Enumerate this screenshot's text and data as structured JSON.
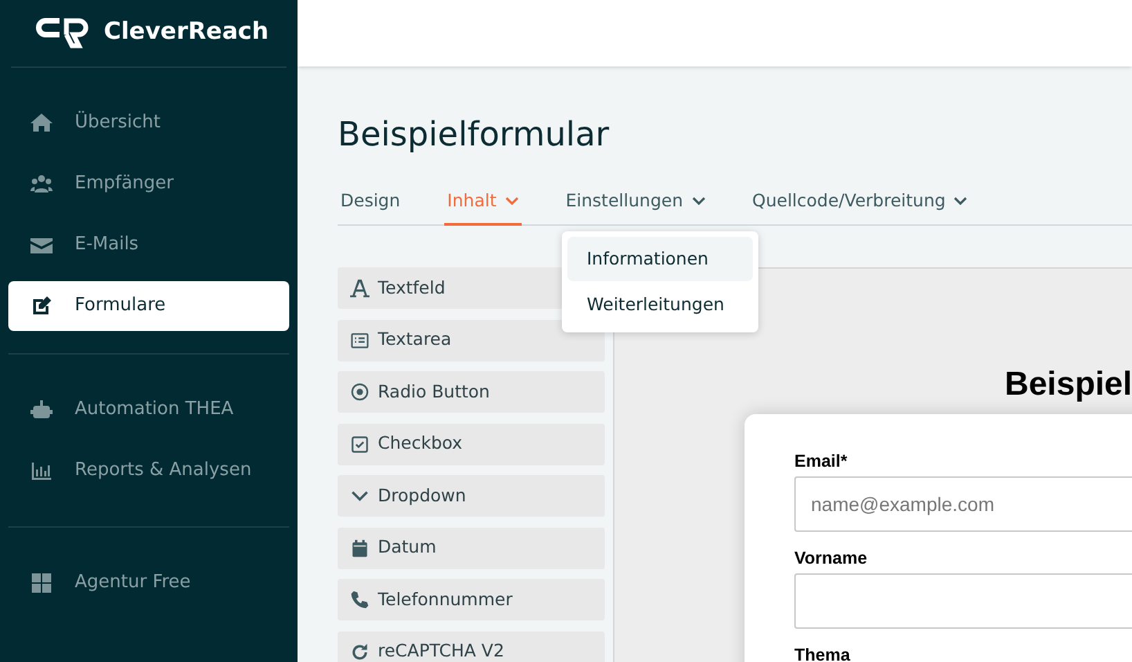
{
  "brand": {
    "name": "CleverReach"
  },
  "sidebar": {
    "groups": [
      {
        "items": [
          {
            "kind": "home",
            "label": "Übersicht",
            "selected": false
          },
          {
            "kind": "users",
            "label": "Empfänger",
            "selected": false
          },
          {
            "kind": "mail",
            "label": "E-Mails",
            "selected": false
          },
          {
            "kind": "edit",
            "label": "Formulare",
            "selected": true
          }
        ]
      },
      {
        "items": [
          {
            "kind": "robot",
            "label": "Automation THEA",
            "selected": false
          },
          {
            "kind": "chart",
            "label": "Reports & Analysen",
            "selected": false
          }
        ]
      },
      {
        "items": [
          {
            "kind": "grid",
            "label": "Agentur Free",
            "selected": false
          }
        ]
      }
    ]
  },
  "page": {
    "title": "Beispielformular"
  },
  "tabs": [
    {
      "label": "Design",
      "selected": false,
      "has_menu": false
    },
    {
      "label": "Inhalt",
      "selected": true,
      "has_menu": true
    },
    {
      "label": "Einstellungen",
      "selected": false,
      "has_menu": true
    },
    {
      "label": "Quellcode/Verbreitung",
      "selected": false,
      "has_menu": true
    }
  ],
  "dropdown": {
    "items": [
      {
        "label": "Informationen",
        "selected": true
      },
      {
        "label": "Weiterleitungen",
        "selected": false
      }
    ]
  },
  "palette": [
    {
      "kind": "text",
      "label": "Textfeld"
    },
    {
      "kind": "textarea",
      "label": "Textarea"
    },
    {
      "kind": "radio",
      "label": "Radio Button"
    },
    {
      "kind": "checkbox",
      "label": "Checkbox"
    },
    {
      "kind": "dropdown",
      "label": "Dropdown"
    },
    {
      "kind": "date",
      "label": "Datum"
    },
    {
      "kind": "phone",
      "label": "Telefonnummer"
    },
    {
      "kind": "captcha",
      "label": "reCAPTCHA V2"
    }
  ],
  "preview": {
    "title": "Beispiel",
    "fields": [
      {
        "label": "Email*",
        "placeholder": "name@example.com"
      },
      {
        "label": "Vorname"
      },
      {
        "label": "Thema"
      }
    ]
  }
}
